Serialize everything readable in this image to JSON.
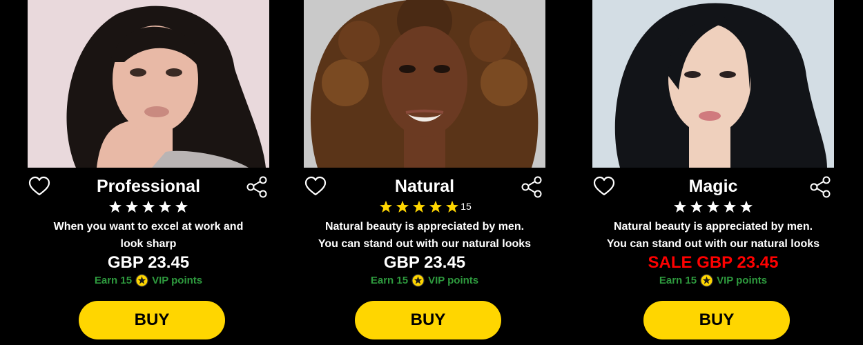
{
  "products": [
    {
      "title": "Professional",
      "rating_count": "",
      "star_color": "#ffffff",
      "description_lines": [
        "When you want to excel at work and",
        "look sharp"
      ],
      "price": "GBP 23.45",
      "on_sale": false,
      "vip": {
        "prefix": "Earn 15",
        "suffix": "VIP points",
        "icon": "star-coin-icon"
      },
      "buy_label": "BUY",
      "photo_bg": "#e9d9dc",
      "hair_color": "#1a1412",
      "skin_color": "#e8b9a6"
    },
    {
      "title": "Natural",
      "rating_count": "15",
      "star_color": "#ffd600",
      "description_lines": [
        "Natural beauty is appreciated by men.",
        "You can stand out with our natural looks"
      ],
      "price": "GBP 23.45",
      "on_sale": false,
      "vip": {
        "prefix": "Earn 15",
        "suffix": "VIP points",
        "icon": "star-coin-icon"
      },
      "buy_label": "BUY",
      "photo_bg": "#c9c9c9",
      "hair_color": "#5a3418",
      "skin_color": "#6b3a22"
    },
    {
      "title": "Magic",
      "rating_count": "",
      "star_color": "#ffffff",
      "description_lines": [
        "Natural beauty is appreciated by men.",
        "You can stand out with our natural looks"
      ],
      "price": "SALE GBP 23.45",
      "on_sale": true,
      "vip": {
        "prefix": "Earn 15",
        "suffix": "VIP points",
        "icon": "star-coin-icon"
      },
      "buy_label": "BUY",
      "photo_bg": "#d3dde4",
      "hair_color": "#121418",
      "skin_color": "#efd0bd"
    }
  ],
  "rating_stars": 5,
  "colors": {
    "background": "#000000",
    "button": "#ffd600",
    "vip_text": "#2e9a3e",
    "sale_text": "#ff0000"
  }
}
